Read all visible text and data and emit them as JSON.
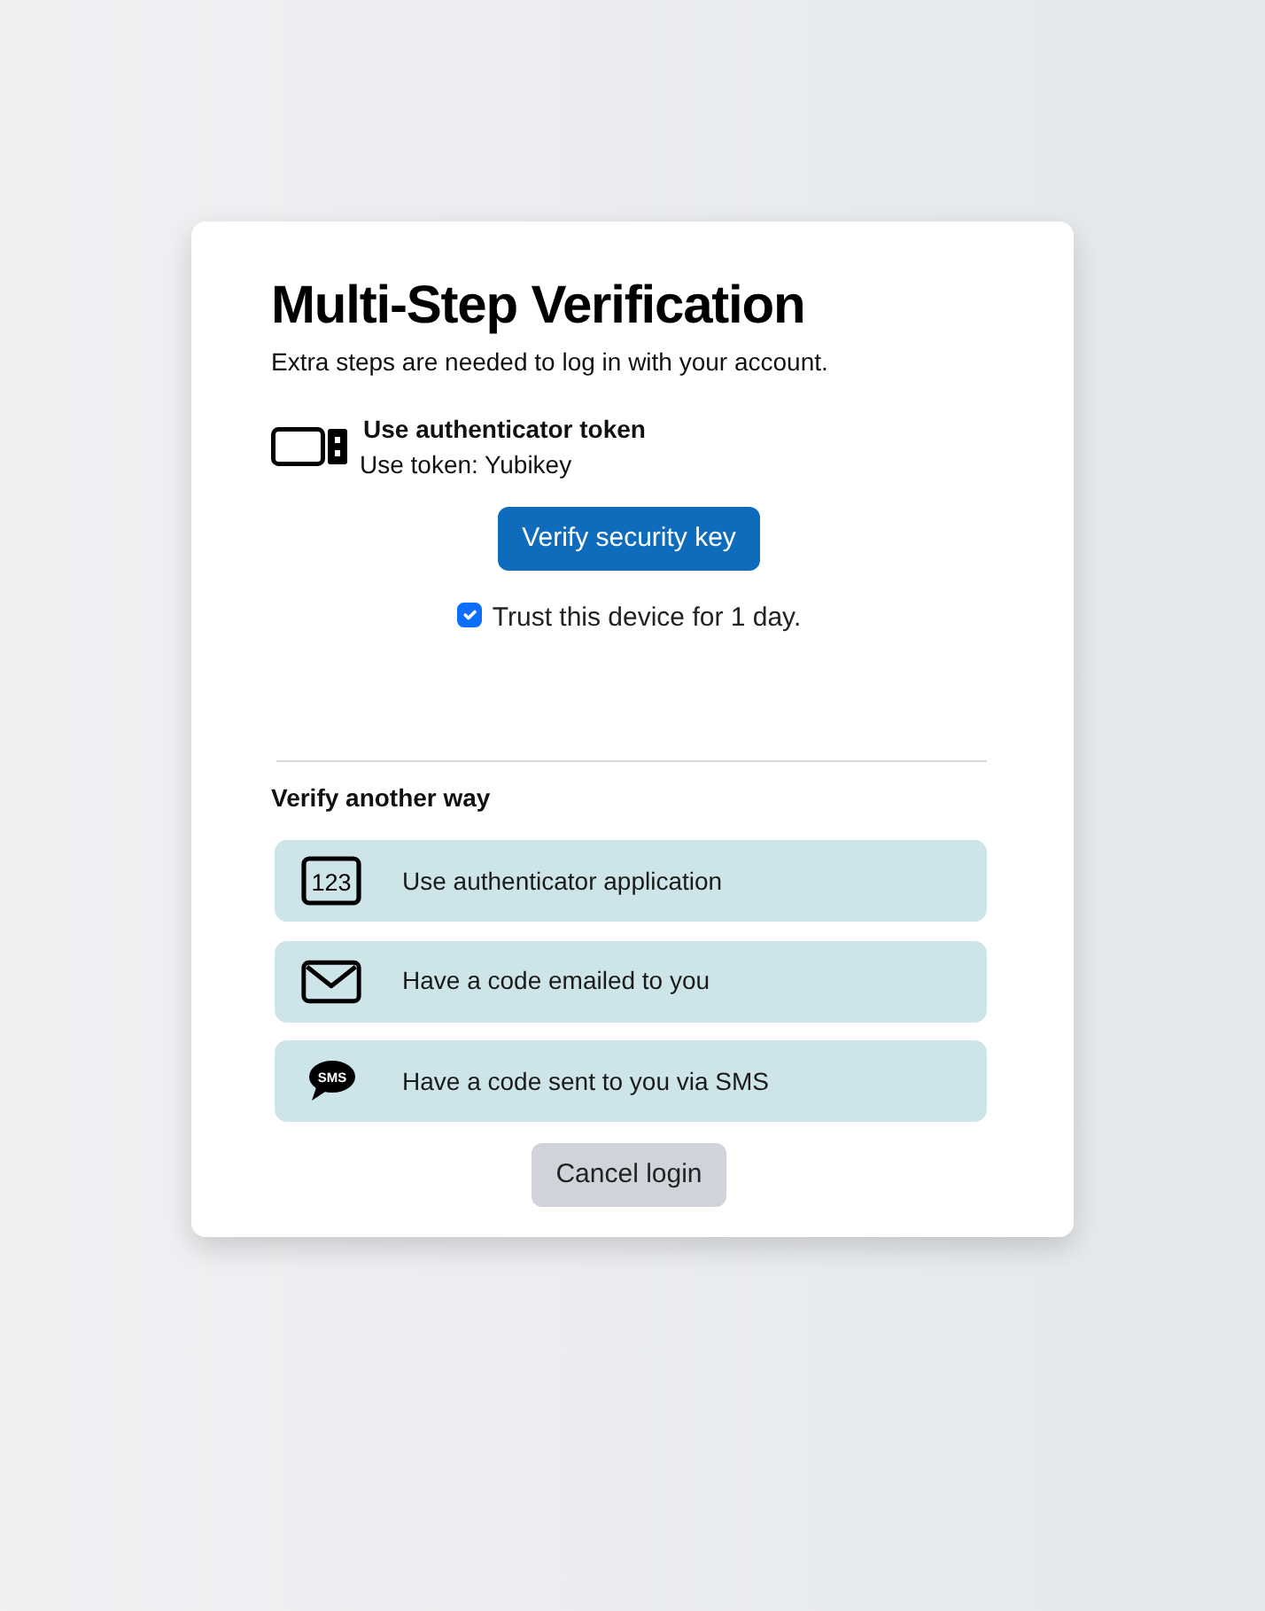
{
  "heading": {
    "title": "Multi-Step Verification",
    "subtitle": "Extra steps are needed to log in with your account."
  },
  "current_method": {
    "title": "Use authenticator token",
    "detail": "Use token: Yubikey"
  },
  "verify_button": "Verify security key",
  "trust_device": {
    "label": "Trust this device for 1 day.",
    "checked": true
  },
  "alternatives": {
    "title": "Verify another way",
    "options": [
      {
        "kind": "app",
        "icon_text": "123",
        "label": "Use authenticator application"
      },
      {
        "kind": "email",
        "label": "Have a code emailed to you"
      },
      {
        "kind": "sms",
        "icon_text": "SMS",
        "label": "Have a code sent to you via SMS"
      }
    ]
  },
  "cancel_button": "Cancel login"
}
